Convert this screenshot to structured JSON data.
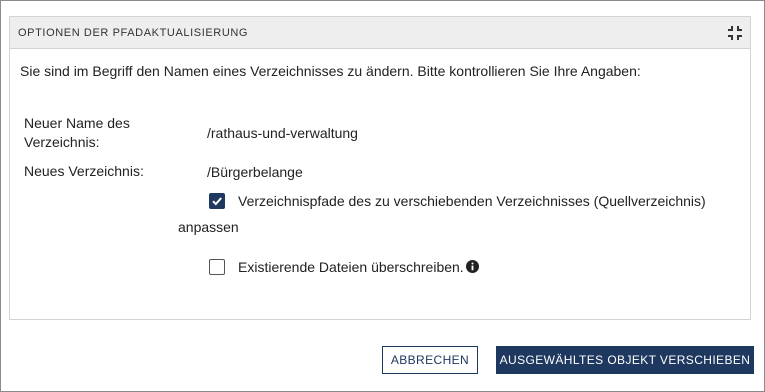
{
  "panel": {
    "title": "OPTIONEN DER PFADAKTUALISIERUNG",
    "collapse_icon": "collapse-icon"
  },
  "intro": "Sie sind im Begriff den Namen eines Verzeichnisses zu ändern. Bitte kontrollieren Sie Ihre Angaben:",
  "fields": {
    "new_name_label_line1": "Neuer Name des",
    "new_name_label_line2": "Verzeichnis:",
    "new_name_value": "/rathaus-und-verwaltung",
    "new_dir_label": "Neues Verzeichnis:",
    "new_dir_value": "/Bürgerbelange"
  },
  "options": {
    "adjust_paths": {
      "checked": true,
      "label_line1": "Verzeichnispfade des zu verschiebenden Verzeichnisses (Quellverzeichnis)",
      "label_line2": "anpassen"
    },
    "overwrite": {
      "checked": false,
      "label": "Existierende Dateien überschreiben.",
      "icon": "info-icon"
    }
  },
  "buttons": {
    "cancel": "ABBRECHEN",
    "move": "AUSGEWÄHLTES OBJEKT VERSCHIEBEN"
  },
  "colors": {
    "primary": "#1e3860",
    "header_bg": "#eeeeee"
  }
}
